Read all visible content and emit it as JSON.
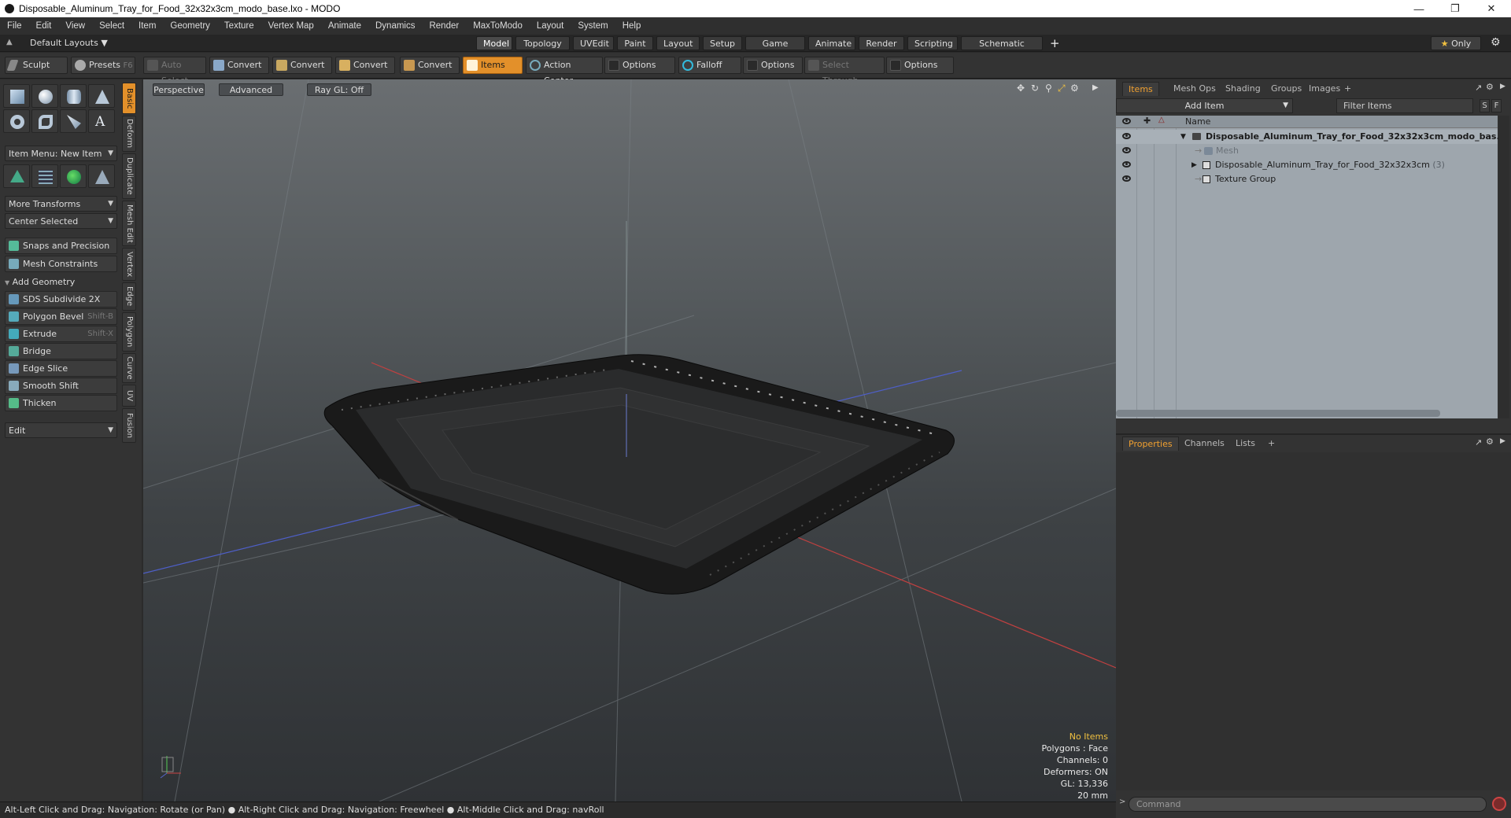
{
  "window": {
    "title": "Disposable_Aluminum_Tray_for_Food_32x32x3cm_modo_base.lxo - MODO"
  },
  "menu": [
    "File",
    "Edit",
    "View",
    "Select",
    "Item",
    "Geometry",
    "Texture",
    "Vertex Map",
    "Animate",
    "Dynamics",
    "Render",
    "MaxToModo",
    "Layout",
    "System",
    "Help"
  ],
  "layout": {
    "preset": "Default Layouts",
    "tabs": [
      "Model",
      "Topology",
      "UVEdit",
      "Paint",
      "Layout",
      "Setup",
      "Game Tools",
      "Animate",
      "Render",
      "Scripting",
      "Schematic Fusion"
    ],
    "active_tab": "Model",
    "add": "+",
    "only": "Only"
  },
  "toolbar": {
    "sculpt": "Sculpt",
    "presets": "Presets",
    "presets_key": "F6",
    "auto_select": "Auto Select",
    "convert1": "Convert",
    "convert2": "Convert",
    "convert3": "Convert",
    "convert4": "Convert",
    "items": "Items",
    "action_center": "Action Center",
    "options1": "Options",
    "falloff": "Falloff",
    "options2": "Options",
    "select_through": "Select Through",
    "options3": "Options"
  },
  "left": {
    "item_menu": "Item Menu: New Item",
    "more_transforms": "More Transforms",
    "center_selected": "Center Selected",
    "snaps": "Snaps and Precision",
    "mesh_constraints": "Mesh Constraints",
    "add_geometry": "Add Geometry",
    "tools": [
      {
        "label": "SDS Subdivide 2X",
        "shortcut": ""
      },
      {
        "label": "Polygon Bevel",
        "shortcut": "Shift-B"
      },
      {
        "label": "Extrude",
        "shortcut": "Shift-X"
      },
      {
        "label": "Bridge",
        "shortcut": ""
      },
      {
        "label": "Edge Slice",
        "shortcut": ""
      },
      {
        "label": "Smooth Shift",
        "shortcut": ""
      },
      {
        "label": "Thicken",
        "shortcut": ""
      }
    ],
    "edit": "Edit",
    "vtabs": [
      "Basic",
      "Deform",
      "Duplicate",
      "Mesh Edit",
      "Vertex",
      "Edge",
      "Polygon",
      "Curve",
      "UV",
      "Fusion"
    ]
  },
  "viewport": {
    "view": "Perspective",
    "shading": "Advanced",
    "raygl": "Ray GL: Off",
    "stats": {
      "items": "No Items",
      "polygons": "Polygons : Face",
      "channels": "Channels: 0",
      "deformers": "Deformers: ON",
      "gl": "GL: 13,336",
      "grid": "20 mm"
    }
  },
  "status": "Alt-Left Click and Drag: Navigation: Rotate (or Pan) ●  Alt-Right Click and Drag: Navigation: Freewheel ●  Alt-Middle Click and Drag: navRoll",
  "items_panel": {
    "tabs": [
      "Items",
      "Mesh Ops",
      "Shading",
      "Groups",
      "Images",
      "+"
    ],
    "add_item": "Add Item",
    "filter": "Filter Items",
    "s": "S",
    "f": "F",
    "name_header": "Name",
    "rows": [
      {
        "label": "Disposable_Aluminum_Tray_for_Food_32x32x3cm_modo_bas..."
      },
      {
        "label": "Mesh"
      },
      {
        "label": "Disposable_Aluminum_Tray_for_Food_32x32x3cm",
        "count": "(3)"
      },
      {
        "label": "Texture Group"
      }
    ]
  },
  "properties_panel": {
    "tabs": [
      "Properties",
      "Channels",
      "Lists",
      "+"
    ],
    "command_placeholder": "Command"
  },
  "colors": {
    "accent": "#e3902a",
    "viewport_top": "#6a6e71",
    "items_bg": "#9ea6ad"
  }
}
